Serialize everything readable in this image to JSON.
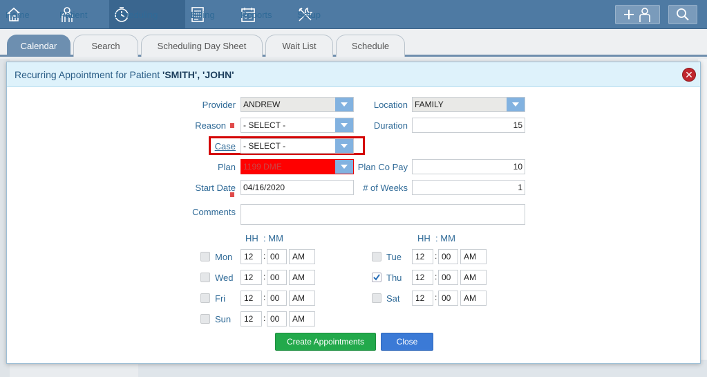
{
  "nav": {
    "items": [
      {
        "label": "Home",
        "icon": "home-icon"
      },
      {
        "label": "Patient",
        "icon": "patient-icon"
      },
      {
        "label": "Scheduling",
        "icon": "clock-icon"
      },
      {
        "label": "Billing",
        "icon": "billing-icon"
      },
      {
        "label": "Reports",
        "icon": "calendar-report-icon"
      },
      {
        "label": "Setup",
        "icon": "tools-icon"
      }
    ],
    "active": "Scheduling"
  },
  "tabs": [
    {
      "label": "Calendar"
    },
    {
      "label": "Search"
    },
    {
      "label": "Scheduling Day Sheet"
    },
    {
      "label": "Wait List"
    },
    {
      "label": "Schedule"
    }
  ],
  "modal": {
    "title_prefix": "Recurring Appointment for Patient ",
    "title_patient": "'SMITH', 'JOHN'",
    "provider": {
      "label": "Provider",
      "value": "ANDREW"
    },
    "location": {
      "label": "Location",
      "value": "FAMILY"
    },
    "reason": {
      "label": "Reason",
      "value": "- SELECT -"
    },
    "duration": {
      "label": "Duration",
      "value": "15"
    },
    "case": {
      "label": "Case",
      "value": "- SELECT -"
    },
    "plan": {
      "label": "Plan",
      "value": "1199 DME"
    },
    "plan_copay": {
      "label": "Plan Co Pay",
      "value": "10"
    },
    "start_date": {
      "label": "Start Date",
      "value": "04/16/2020"
    },
    "weeks": {
      "label": "# of Weeks",
      "value": "1"
    },
    "comments": {
      "label": "Comments",
      "value": ""
    },
    "hh_label": "HH",
    "mm_label": "MM",
    "colon": ":",
    "days": {
      "mon": {
        "label": "Mon",
        "checked": false,
        "hh": "12",
        "mm": "00",
        "ampm": "AM"
      },
      "wed": {
        "label": "Wed",
        "checked": false,
        "hh": "12",
        "mm": "00",
        "ampm": "AM"
      },
      "fri": {
        "label": "Fri",
        "checked": false,
        "hh": "12",
        "mm": "00",
        "ampm": "AM"
      },
      "sun": {
        "label": "Sun",
        "checked": false,
        "hh": "12",
        "mm": "00",
        "ampm": "AM"
      },
      "tue": {
        "label": "Tue",
        "checked": false,
        "hh": "12",
        "mm": "00",
        "ampm": "AM"
      },
      "thu": {
        "label": "Thu",
        "checked": true,
        "hh": "12",
        "mm": "00",
        "ampm": "AM"
      },
      "sat": {
        "label": "Sat",
        "checked": false,
        "hh": "12",
        "mm": "00",
        "ampm": "AM"
      }
    },
    "create_label": "Create Appointments",
    "close_label": "Close"
  },
  "colors": {
    "nav_bg": "#4e7aa3",
    "plan_bg": "#ff0000",
    "create_btn": "#22a94b",
    "close_btn": "#3b7ad6",
    "dropdown": "#82b2e0"
  }
}
